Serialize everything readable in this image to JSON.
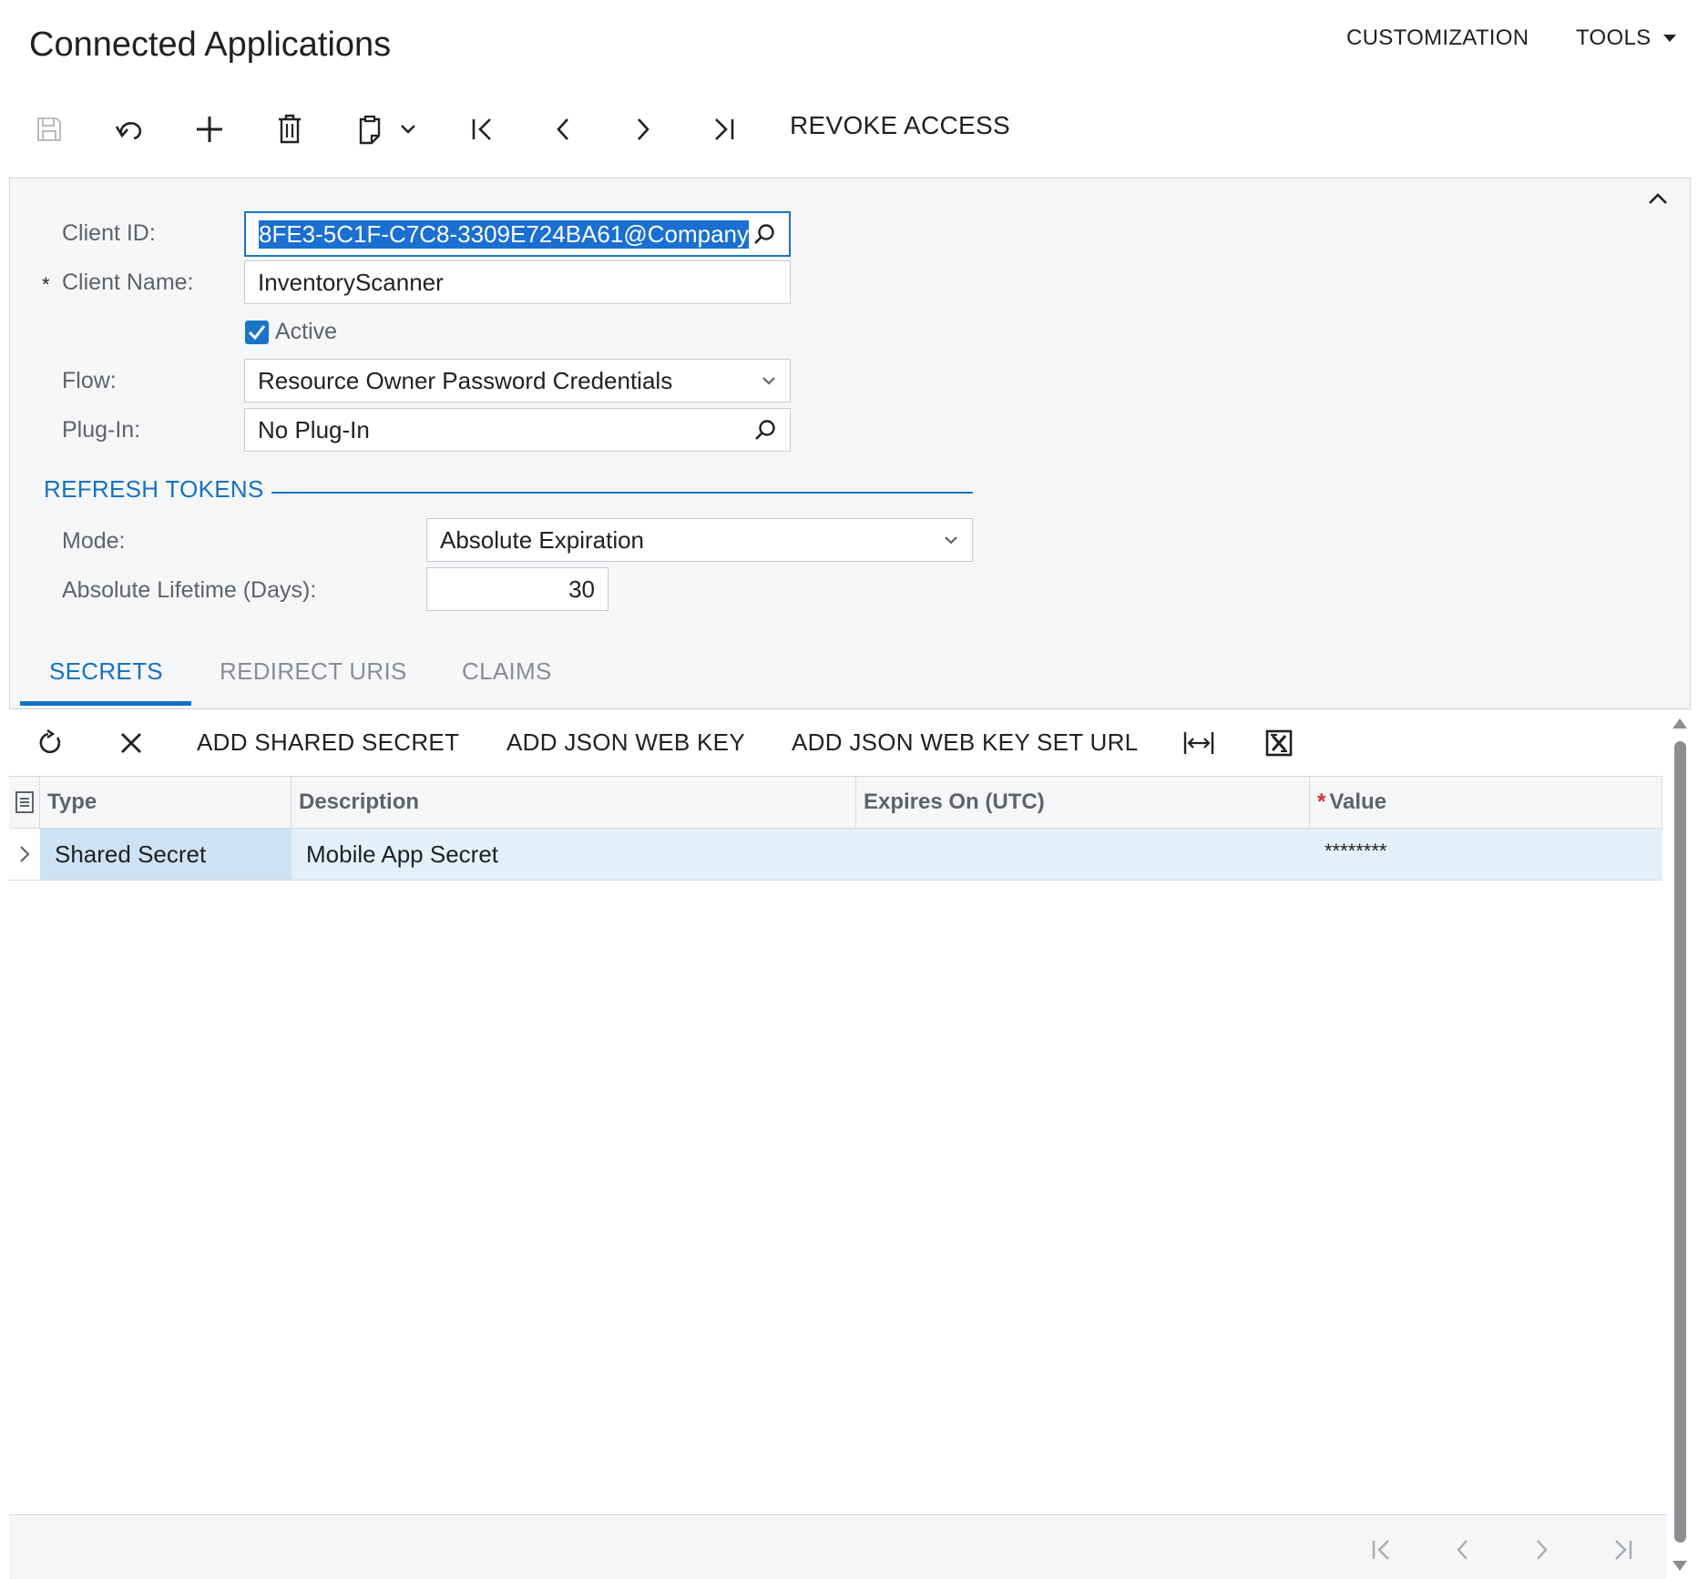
{
  "header": {
    "title": "Connected Applications",
    "menu": {
      "customization": "CUSTOMIZATION",
      "tools": "TOOLS"
    }
  },
  "toolbar": {
    "icons": [
      "save-icon",
      "undo-icon",
      "add-icon",
      "delete-icon",
      "copy-paste-icon",
      "chevron-down-icon",
      "first-record-icon",
      "previous-record-icon",
      "next-record-icon",
      "last-record-icon"
    ],
    "revoke_access": "REVOKE ACCESS"
  },
  "form": {
    "client_id": {
      "label": "Client ID:",
      "value": "8FE3-5C1F-C7C8-3309E724BA61@Company"
    },
    "client_name": {
      "label": "Client Name:",
      "required_mark": "*",
      "value": "InventoryScanner"
    },
    "active": {
      "label": "Active",
      "checked": true
    },
    "flow": {
      "label": "Flow:",
      "value": "Resource Owner Password Credentials"
    },
    "plugin": {
      "label": "Plug-In:",
      "value": "No Plug-In"
    }
  },
  "refresh_tokens": {
    "title": "REFRESH TOKENS",
    "mode": {
      "label": "Mode:",
      "value": "Absolute Expiration"
    },
    "lifetime": {
      "label": "Absolute Lifetime (Days):",
      "value": "30"
    }
  },
  "tabs": [
    {
      "label": "SECRETS",
      "active": true
    },
    {
      "label": "REDIRECT URIS",
      "active": false
    },
    {
      "label": "CLAIMS",
      "active": false
    }
  ],
  "grid_toolbar": {
    "add_shared_secret": "ADD SHARED SECRET",
    "add_json_web_key": "ADD JSON WEB KEY",
    "add_json_web_key_set_url": "ADD JSON WEB KEY SET URL"
  },
  "grid": {
    "columns": [
      "Type",
      "Description",
      "Expires On (UTC)",
      "Value"
    ],
    "required_mark": "*",
    "rows": [
      {
        "type": "Shared Secret",
        "description": "Mobile App Secret",
        "expires_on": "",
        "value": "********"
      }
    ]
  },
  "colors": {
    "accent": "#1672c4",
    "selected_row": "#e3f0fa",
    "panel": "#f5f6f7"
  }
}
